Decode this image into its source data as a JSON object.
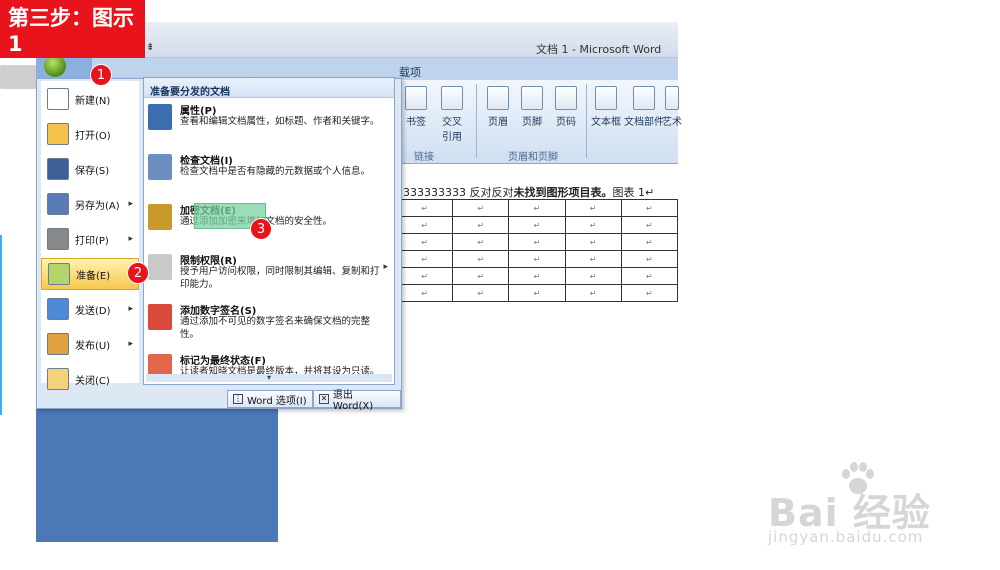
{
  "banner": {
    "text": "第三步：图示1"
  },
  "window": {
    "title": "文档 1 - Microsoft Word",
    "qat_arrow": "⇟"
  },
  "ribbon": {
    "tab_label": "载项",
    "buttons": [
      "书签",
      "交叉\n引用",
      "页眉",
      "页脚",
      "页码",
      "文本框",
      "文档部件",
      "艺术"
    ],
    "groups": [
      "链接",
      "页眉和页脚"
    ]
  },
  "document": {
    "line_prefix": "3333333333 反对反对",
    "line_bold": "未找到图形项目表。",
    "line_suffix": "图表 1↵",
    "cell_mark": "↵",
    "rows": 6,
    "cols": 5
  },
  "office_menu": {
    "items": [
      {
        "label": "新建(N)",
        "icon": "new-document-icon",
        "arrow": false
      },
      {
        "label": "打开(O)",
        "icon": "open-folder-icon",
        "arrow": false
      },
      {
        "label": "保存(S)",
        "icon": "save-disk-icon",
        "arrow": false
      },
      {
        "label": "另存为(A)",
        "icon": "save-as-icon",
        "arrow": true
      },
      {
        "label": "打印(P)",
        "icon": "printer-icon",
        "arrow": true
      },
      {
        "label": "准备(E)",
        "icon": "prepare-pen-icon",
        "arrow": true,
        "active": true
      },
      {
        "label": "发送(D)",
        "icon": "send-icon",
        "arrow": true
      },
      {
        "label": "发布(U)",
        "icon": "publish-icon",
        "arrow": true
      },
      {
        "label": "关闭(C)",
        "icon": "close-folder-icon",
        "arrow": false
      }
    ],
    "submenu": {
      "header": "准备要分发的文档",
      "items": [
        {
          "title": "属性(P)",
          "desc": "查看和编辑文档属性，如标题、作者和关键字。",
          "icon": "properties-icon"
        },
        {
          "title": "检查文档(I)",
          "desc": "检查文档中是否有隐藏的元数据或个人信息。",
          "icon": "inspect-document-icon"
        },
        {
          "title": "加密文档(E)",
          "desc": "通过添加加密来增加文档的安全性。",
          "icon": "encrypt-lock-icon"
        },
        {
          "title": "限制权限(R)",
          "desc": "授予用户访问权限，同时限制其编辑、复制和打印能力。",
          "icon": "restrict-permission-icon",
          "arrow": true
        },
        {
          "title": "添加数字签名(S)",
          "desc": "通过添加不可见的数字签名来确保文档的完整性。",
          "icon": "digital-signature-icon"
        },
        {
          "title": "标记为最终状态(F)",
          "desc": "让读者知晓文档是最终版本，并将其设为只读。",
          "icon": "mark-final-icon"
        }
      ]
    },
    "footer": {
      "options": "Word 选项(I)",
      "exit": "退出 Word(X)"
    }
  },
  "markers": [
    "1",
    "2",
    "3"
  ],
  "watermark": {
    "brand": "Bai 经验",
    "url": "jingyan.baidu.com"
  },
  "colors": {
    "banner": "#e8131b",
    "accent": "#4b78b7",
    "highlight": "#f7c74e"
  }
}
